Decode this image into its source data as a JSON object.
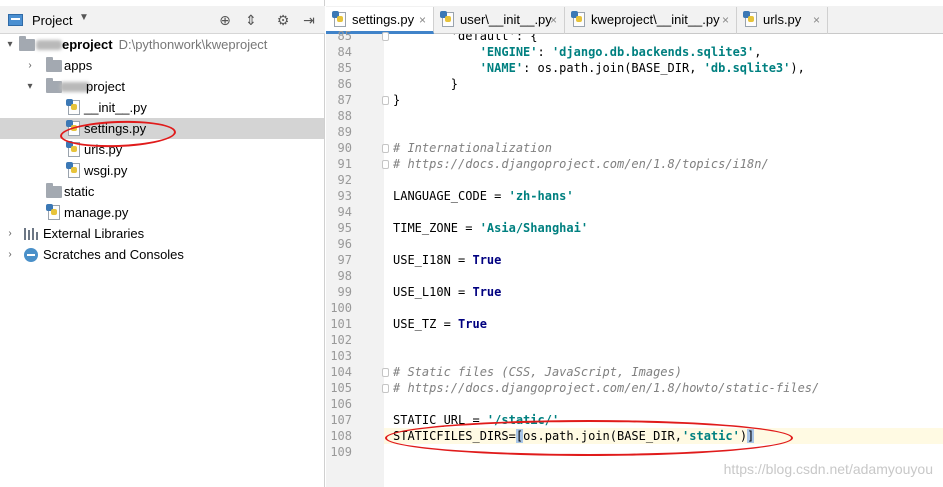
{
  "project_panel": {
    "title": "Project",
    "dropdown_icon": "chevron-down-icon",
    "header_buttons": [
      "locate-icon",
      "collapse-icon",
      "gear-icon",
      "hide-icon"
    ],
    "root": {
      "name": "eproject",
      "path": "D:\\pythonwork\\kweproject"
    },
    "items": [
      {
        "label": "apps"
      },
      {
        "label": "project"
      },
      {
        "label": "__init__.py"
      },
      {
        "label": "settings.py"
      },
      {
        "label": "urls.py"
      },
      {
        "label": "wsgi.py"
      },
      {
        "label": "static"
      },
      {
        "label": "manage.py"
      },
      {
        "label": "External Libraries"
      },
      {
        "label": "Scratches and Consoles"
      }
    ]
  },
  "tabs": [
    {
      "label": "settings.py",
      "active": true
    },
    {
      "label": "user\\__init__.py"
    },
    {
      "label": "kweproject\\__init__.py"
    },
    {
      "label": "urls.py"
    }
  ],
  "tab_close_symbol": "×",
  "code": {
    "line_numbers": [
      "85",
      "84",
      "85",
      "86",
      "87",
      "88",
      "89",
      "90",
      "91",
      "92",
      "93",
      "94",
      "95",
      "96",
      "97",
      "98",
      "99",
      "100",
      "101",
      "102",
      "103",
      "104",
      "105",
      "106",
      "107",
      "108",
      "109"
    ],
    "lines": [
      [
        {
          "t": "        'default': {",
          "c": "plain"
        }
      ],
      [
        {
          "t": "            ",
          "c": "plain"
        },
        {
          "t": "'ENGINE'",
          "c": "str"
        },
        {
          "t": ": ",
          "c": "plain"
        },
        {
          "t": "'django.db.backends.sqlite3'",
          "c": "str"
        },
        {
          "t": ",",
          "c": "plain"
        }
      ],
      [
        {
          "t": "            ",
          "c": "plain"
        },
        {
          "t": "'NAME'",
          "c": "str"
        },
        {
          "t": ": os.path.join(BASE_DIR, ",
          "c": "plain"
        },
        {
          "t": "'db.sqlite3'",
          "c": "str"
        },
        {
          "t": "),",
          "c": "plain"
        }
      ],
      [
        {
          "t": "        }",
          "c": "plain"
        }
      ],
      [
        {
          "t": "}",
          "c": "plain"
        }
      ],
      [],
      [],
      [
        {
          "t": "# Internationalization",
          "c": "comment"
        }
      ],
      [
        {
          "t": "# https://docs.djangoproject.com/en/1.8/topics/i18n/",
          "c": "comment"
        }
      ],
      [],
      [
        {
          "t": "LANGUAGE_CODE = ",
          "c": "plain"
        },
        {
          "t": "'zh-hans'",
          "c": "str"
        }
      ],
      [],
      [
        {
          "t": "TIME_ZONE = ",
          "c": "plain"
        },
        {
          "t": "'Asia/Shanghai'",
          "c": "str"
        }
      ],
      [],
      [
        {
          "t": "USE_I18N = ",
          "c": "plain"
        },
        {
          "t": "True",
          "c": "kw"
        }
      ],
      [],
      [
        {
          "t": "USE_L10N = ",
          "c": "plain"
        },
        {
          "t": "True",
          "c": "kw"
        }
      ],
      [],
      [
        {
          "t": "USE_TZ = ",
          "c": "plain"
        },
        {
          "t": "True",
          "c": "kw"
        }
      ],
      [],
      [],
      [
        {
          "t": "# Static files (CSS, JavaScript, Images)",
          "c": "comment"
        }
      ],
      [
        {
          "t": "# https://docs.djangoproject.com/en/1.8/howto/static-files/",
          "c": "comment"
        }
      ],
      [],
      [
        {
          "t": "STATIC_URL = ",
          "c": "plain"
        },
        {
          "t": "'/static/'",
          "c": "str"
        }
      ],
      [
        {
          "t": "STATICFILES_DIRS=",
          "c": "plain"
        },
        {
          "t": "[",
          "c": "cursor"
        },
        {
          "t": "os.path.join(BASE_DIR,",
          "c": "plain"
        },
        {
          "t": "'static'",
          "c": "str"
        },
        {
          "t": ")",
          "c": "plain"
        },
        {
          "t": "]",
          "c": "cursor"
        }
      ],
      []
    ],
    "current_line_index": 25
  },
  "watermark": "https://blog.csdn.net/adamyouyou",
  "colors": {
    "annotation": "#e01b1b",
    "tab_active_underline": "#4083c9",
    "string": "#008080",
    "keyword": "#000080",
    "comment": "#808080"
  }
}
